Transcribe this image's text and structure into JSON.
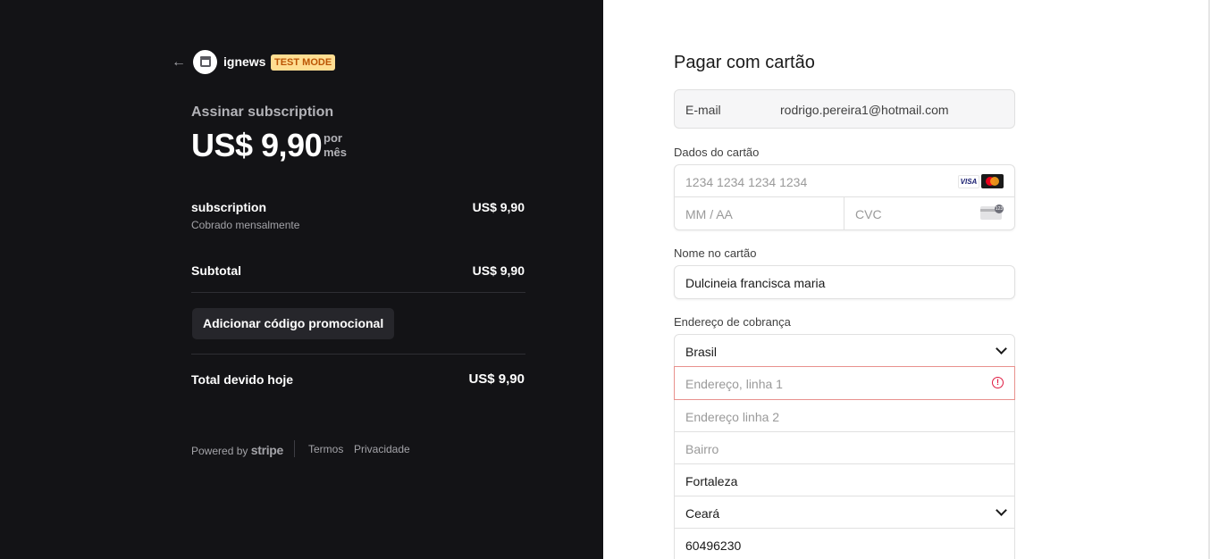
{
  "header": {
    "brand_name": "ignews",
    "test_badge": "TEST MODE"
  },
  "summary": {
    "subscribe_title": "Assinar subscription",
    "price": "US$ 9,90",
    "per_line1": "por",
    "per_line2": "mês",
    "item_name": "subscription",
    "item_sub": "Cobrado mensalmente",
    "item_price": "US$ 9,90",
    "subtotal_label": "Subtotal",
    "subtotal_value": "US$ 9,90",
    "promo_button": "Adicionar código promocional",
    "total_label": "Total devido hoje",
    "total_value": "US$ 9,90"
  },
  "footer": {
    "powered_by": "Powered by",
    "stripe": "stripe",
    "terms": "Termos",
    "privacy": "Privacidade"
  },
  "payment": {
    "title": "Pagar com cartão",
    "email_label": "E-mail",
    "email_value": "rodrigo.pereira1@hotmail.com",
    "card_label": "Dados do cartão",
    "card_number_placeholder": "1234 1234 1234 1234",
    "card_exp_placeholder": "MM / AA",
    "card_cvc_placeholder": "CVC",
    "visa_text": "VISA",
    "name_label": "Nome no cartão",
    "name_value": "Dulcineia francisca maria",
    "address_label": "Endereço de cobrança",
    "country": "Brasil",
    "address1_placeholder": "Endereço, linha 1",
    "address2_placeholder": "Endereço linha 2",
    "neighborhood_placeholder": "Bairro",
    "city": "Fortaleza",
    "state": "Ceará",
    "zip": "60496230"
  },
  "colors": {
    "left_bg": "#131316",
    "badge_bg": "#ffde92",
    "badge_text": "#bb5504",
    "error_border": "#e8918d",
    "error_icon": "#df1b41"
  }
}
